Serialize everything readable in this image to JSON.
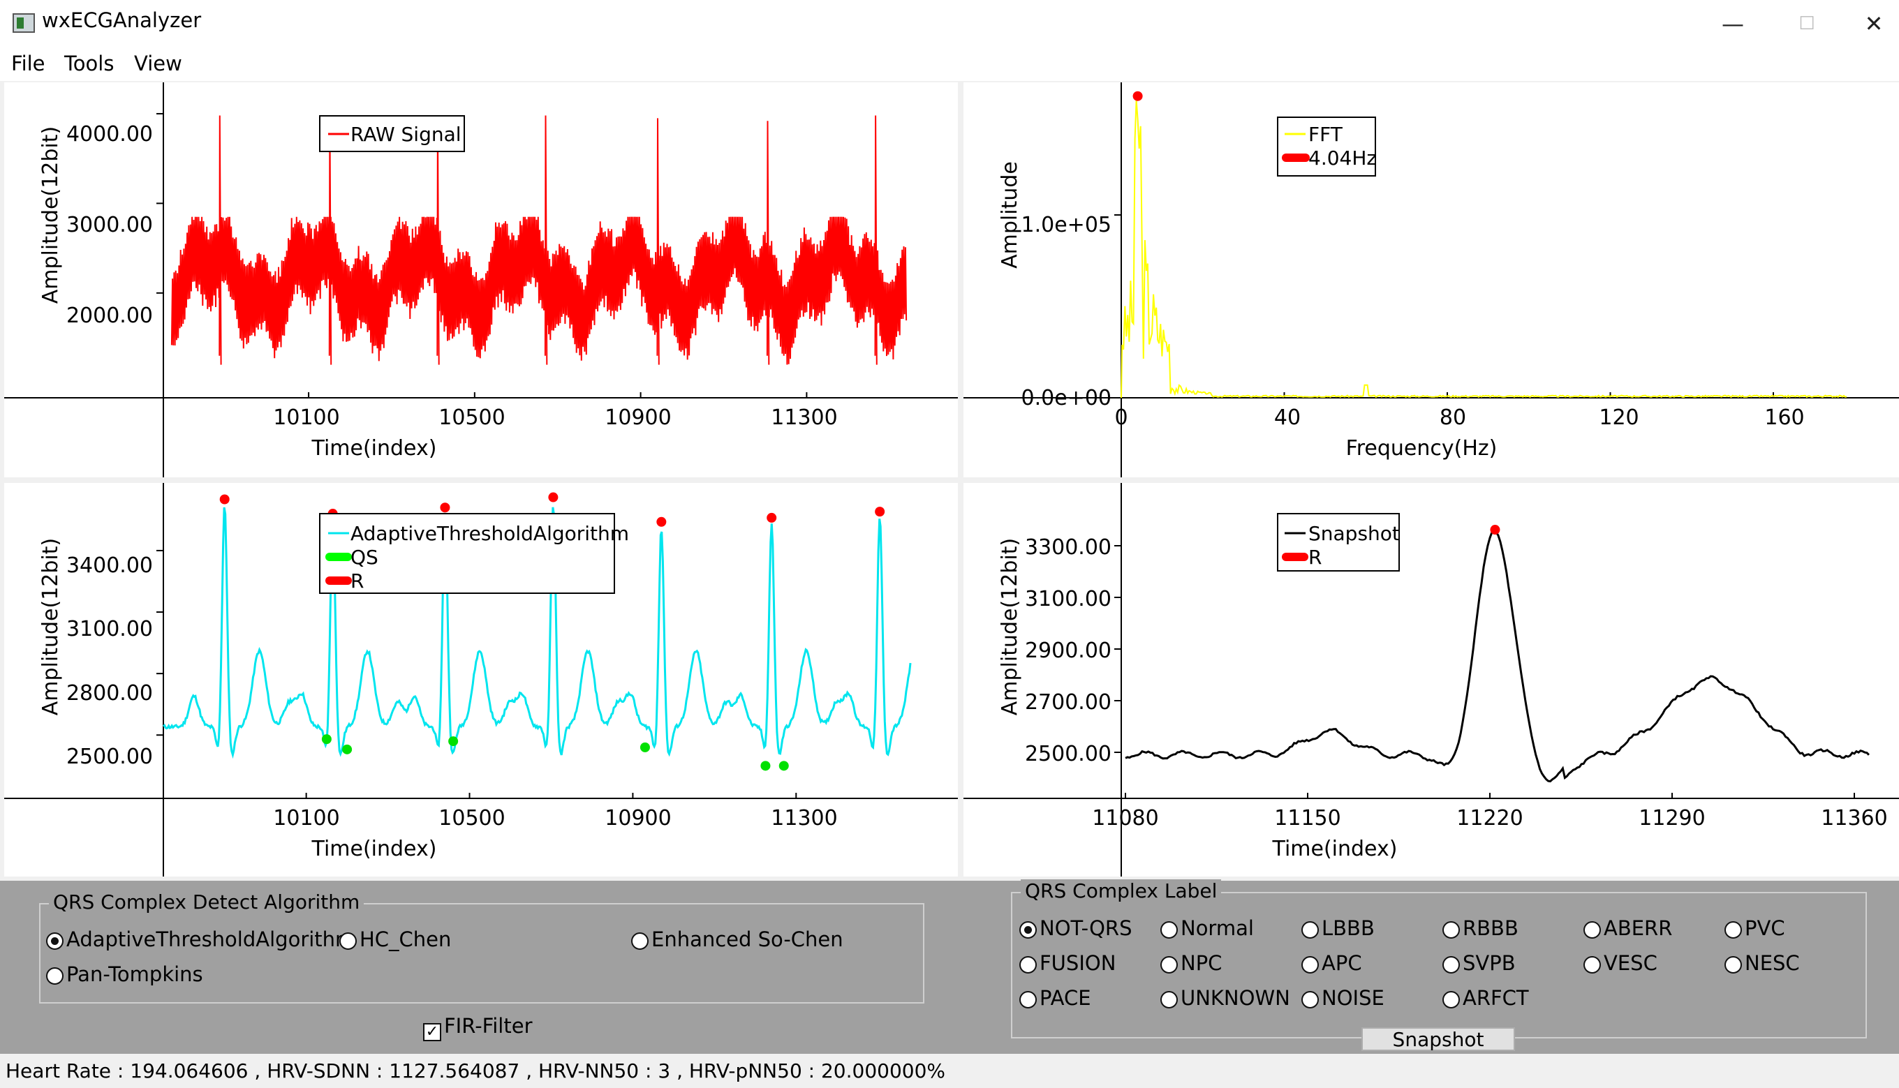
{
  "window": {
    "title": "wxECGAnalyzer",
    "minimize": "—",
    "maximize": "☐",
    "close": "✕"
  },
  "menu": [
    "File",
    "Tools",
    "View"
  ],
  "charts": {
    "raw": {
      "legend": "RAW Signal",
      "ylabel": "Amplitude(12bit)",
      "xlabel": "Time(index)",
      "yticks": [
        "4000.00",
        "3000.00",
        "2000.00"
      ],
      "xticks": [
        "10100",
        "10500",
        "10900",
        "11300"
      ]
    },
    "fft": {
      "legend": "FFT",
      "peak_label": "4.04Hz",
      "ylabel": "Amplitude",
      "xlabel": "Frequency(Hz)",
      "yticks": [
        "1.0e+05",
        "0.0e+00"
      ],
      "xticks": [
        "0",
        "40",
        "80",
        "120",
        "160"
      ]
    },
    "detect": {
      "legend": [
        "AdaptiveThresholdAlgorithm",
        "QS",
        "R"
      ],
      "ylabel": "Amplitude(12bit)",
      "xlabel": "Time(index)",
      "yticks": [
        "3400.00",
        "3100.00",
        "2800.00",
        "2500.00"
      ],
      "xticks": [
        "10100",
        "10500",
        "10900",
        "11300"
      ]
    },
    "snapshot": {
      "legend": [
        "Snapshot",
        "R"
      ],
      "ylabel": "Amplitude(12bit)",
      "xlabel": "Time(index)",
      "yticks": [
        "3300.00",
        "3100.00",
        "2900.00",
        "2700.00",
        "2500.00"
      ],
      "xticks": [
        "11080",
        "11150",
        "11220",
        "11290",
        "11360"
      ]
    }
  },
  "chart_data": [
    {
      "type": "line",
      "title": "",
      "series": [
        {
          "name": "RAW Signal",
          "color": "#ff0000"
        }
      ],
      "xlabel": "Time(index)",
      "ylabel": "Amplitude(12bit)",
      "xlim": [
        9750,
        11550
      ],
      "ylim": [
        1080,
        4350
      ],
      "r_peaks_x": [
        9885,
        10150,
        10410,
        10670,
        10940,
        11205,
        11465
      ],
      "baseline_range": [
        1400,
        2750
      ]
    },
    {
      "type": "line",
      "title": "",
      "series": [
        {
          "name": "FFT",
          "color": "#ffff00"
        },
        {
          "name": "4.04Hz",
          "color": "#ff0000",
          "x": [
            4.04
          ],
          "y": [
            165000
          ]
        }
      ],
      "xlabel": "Frequency(Hz)",
      "ylabel": "Amplitude",
      "xlim": [
        0,
        180
      ],
      "ylim": [
        0,
        200000
      ]
    },
    {
      "type": "line",
      "title": "",
      "series": [
        {
          "name": "AdaptiveThresholdAlgorithm",
          "color": "#00e5ee"
        },
        {
          "name": "QS",
          "color": "#00ff00"
        },
        {
          "name": "R",
          "color": "#ff0000"
        }
      ],
      "xlabel": "Time(index)",
      "ylabel": "Amplitude(12bit)",
      "xlim": [
        9750,
        11580
      ],
      "ylim": [
        2300,
        3730
      ],
      "r_peaks": [
        {
          "x": 9900,
          "y": 3650
        },
        {
          "x": 10165,
          "y": 3580
        },
        {
          "x": 10440,
          "y": 3610
        },
        {
          "x": 10705,
          "y": 3660
        },
        {
          "x": 10970,
          "y": 3540
        },
        {
          "x": 11240,
          "y": 3560
        },
        {
          "x": 11505,
          "y": 3590
        }
      ],
      "qs_points": [
        {
          "x": 10150,
          "y": 2480
        },
        {
          "x": 10200,
          "y": 2430
        },
        {
          "x": 10460,
          "y": 2470
        },
        {
          "x": 10930,
          "y": 2440
        },
        {
          "x": 11225,
          "y": 2350
        },
        {
          "x": 11270,
          "y": 2350
        }
      ]
    },
    {
      "type": "line",
      "title": "",
      "series": [
        {
          "name": "Snapshot",
          "color": "#000000"
        },
        {
          "name": "R",
          "color": "#ff0000",
          "x": [
            11222
          ],
          "y": [
            3362
          ]
        }
      ],
      "xlabel": "Time(index)",
      "ylabel": "Amplitude(12bit)",
      "xlim": [
        11080,
        11366
      ],
      "ylim": [
        2420,
        3380
      ]
    }
  ],
  "algorithm_group": {
    "label": "QRS Complex Detect Algorithm",
    "options": [
      "AdaptiveThresholdAlgorithm",
      "HC_Chen",
      "Enhanced So-Chen",
      "Pan-Tompkins"
    ],
    "selected": "AdaptiveThresholdAlgorithm",
    "fir_filter": "FIR-Filter",
    "fir_checked": true
  },
  "label_group": {
    "label": "QRS Complex Label",
    "options": [
      "NOT-QRS",
      "Normal",
      "LBBB",
      "RBBB",
      "ABERR",
      "PVC",
      "FUSION",
      "NPC",
      "APC",
      "SVPB",
      "VESC",
      "NESC",
      "PACE",
      "UNKNOWN",
      "NOISE",
      "ARFCT"
    ],
    "selected": "NOT-QRS",
    "snapshot_button": "Snapshot"
  },
  "status": "Heart Rate : 194.064606 , HRV-SDNN : 1127.564087 , HRV-NN50 : 3 , HRV-pNN50 : 20.000000%"
}
